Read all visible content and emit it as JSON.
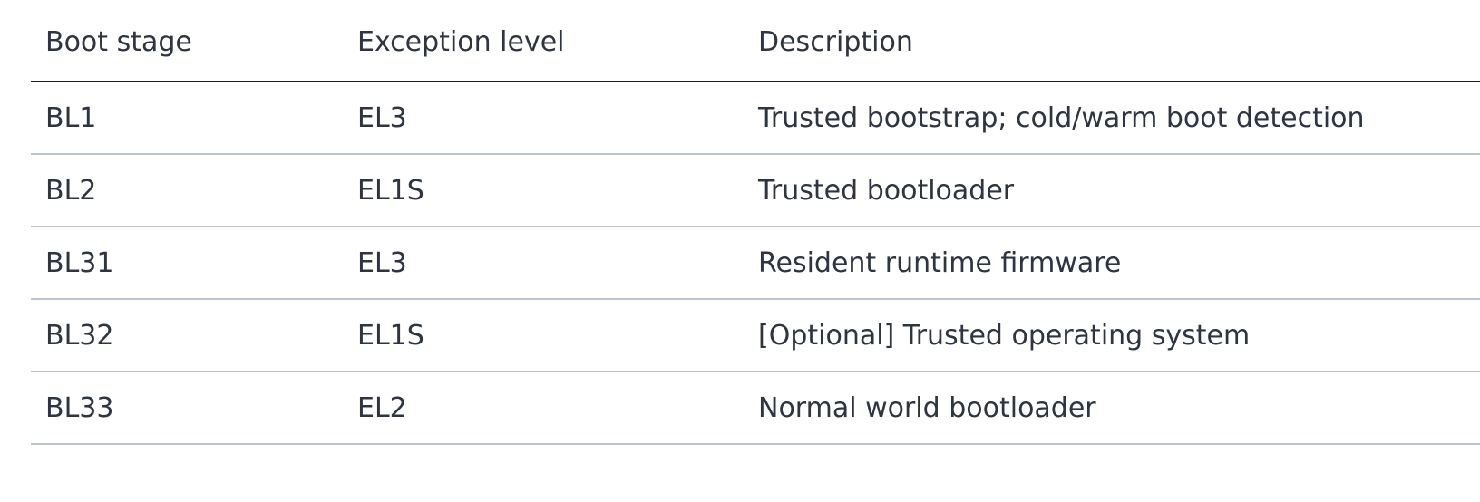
{
  "table": {
    "headers": [
      "Boot stage",
      "Exception level",
      "Description"
    ],
    "rows": [
      [
        "BL1",
        "EL3",
        "Trusted bootstrap; cold/warm boot detection"
      ],
      [
        "BL2",
        "EL1S",
        "Trusted bootloader"
      ],
      [
        "BL31",
        "EL3",
        "Resident runtime firmware"
      ],
      [
        "BL32",
        "EL1S",
        "[Optional] Trusted operating system"
      ],
      [
        "BL33",
        "EL2",
        "Normal world bootloader"
      ]
    ]
  },
  "colors": {
    "text": "#2e3440",
    "header_rule": "#1c1f26",
    "row_rule": "#b9c4d0"
  }
}
